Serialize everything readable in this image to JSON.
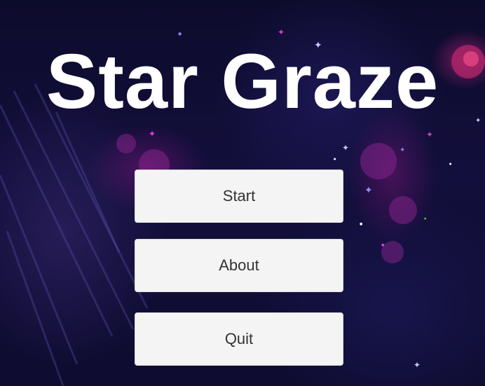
{
  "game": {
    "title": "Star Graze"
  },
  "menu": {
    "start_label": "Start",
    "about_label": "About",
    "quit_label": "Quit"
  },
  "colors": {
    "background": "#0c0a2a",
    "button_bg": "#f4f4f4",
    "button_text": "#333333",
    "title_text": "#ffffff",
    "nebula_magenta": "#8a1a8a"
  }
}
